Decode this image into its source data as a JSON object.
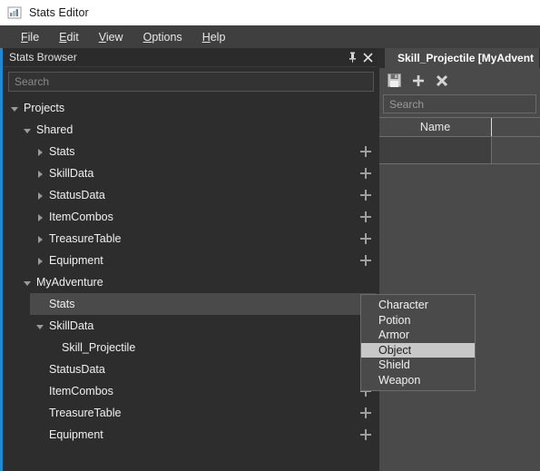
{
  "window": {
    "title": "Stats Editor",
    "icon": "bar-chart-icon"
  },
  "menubar": {
    "items": [
      {
        "label": "File",
        "accesskey": "F",
        "rest": "ile"
      },
      {
        "label": "Edit",
        "accesskey": "E",
        "rest": "dit"
      },
      {
        "label": "View",
        "accesskey": "V",
        "rest": "iew"
      },
      {
        "label": "Options",
        "accesskey": "O",
        "rest": "ptions"
      },
      {
        "label": "Help",
        "accesskey": "H",
        "rest": "elp"
      }
    ]
  },
  "stats_browser": {
    "title": "Stats Browser",
    "pin_icon": "pin-icon",
    "close_icon": "close-icon",
    "search": {
      "value": "",
      "placeholder": "Search"
    },
    "tree": [
      {
        "label": "Projects",
        "indent": 0,
        "state": "expanded",
        "plus": false,
        "selected": false
      },
      {
        "label": "Shared",
        "indent": 1,
        "state": "expanded",
        "plus": false,
        "selected": false
      },
      {
        "label": "Stats",
        "indent": 2,
        "state": "collapsed",
        "plus": true,
        "selected": false
      },
      {
        "label": "SkillData",
        "indent": 2,
        "state": "collapsed",
        "plus": true,
        "selected": false
      },
      {
        "label": "StatusData",
        "indent": 2,
        "state": "collapsed",
        "plus": true,
        "selected": false
      },
      {
        "label": "ItemCombos",
        "indent": 2,
        "state": "collapsed",
        "plus": true,
        "selected": false
      },
      {
        "label": "TreasureTable",
        "indent": 2,
        "state": "collapsed",
        "plus": true,
        "selected": false
      },
      {
        "label": "Equipment",
        "indent": 2,
        "state": "collapsed",
        "plus": true,
        "selected": false
      },
      {
        "label": "MyAdventure",
        "indent": 1,
        "state": "expanded",
        "plus": false,
        "selected": false
      },
      {
        "label": "Stats",
        "indent": 2,
        "state": "none",
        "plus": true,
        "selected": true
      },
      {
        "label": "SkillData",
        "indent": 2,
        "state": "expanded",
        "plus": true,
        "selected": false
      },
      {
        "label": "Skill_Projectile",
        "indent": 3,
        "state": "none",
        "plus": false,
        "selected": false
      },
      {
        "label": "StatusData",
        "indent": 2,
        "state": "none",
        "plus": true,
        "selected": false
      },
      {
        "label": "ItemCombos",
        "indent": 2,
        "state": "none",
        "plus": true,
        "selected": false
      },
      {
        "label": "TreasureTable",
        "indent": 2,
        "state": "none",
        "plus": true,
        "selected": false
      },
      {
        "label": "Equipment",
        "indent": 2,
        "state": "none",
        "plus": true,
        "selected": false
      }
    ]
  },
  "context_menu": {
    "items": [
      {
        "label": "Character",
        "highlighted": false
      },
      {
        "label": "Potion",
        "highlighted": false
      },
      {
        "label": "Armor",
        "highlighted": false
      },
      {
        "label": "Object",
        "highlighted": true
      },
      {
        "label": "Shield",
        "highlighted": false
      },
      {
        "label": "Weapon",
        "highlighted": false
      }
    ]
  },
  "editor": {
    "tab": {
      "label": "Skill_Projectile [MyAdvent"
    },
    "toolbar": {
      "save_icon": "save-icon",
      "add_icon": "plus-icon",
      "delete_icon": "delete-x-icon"
    },
    "search": {
      "value": "",
      "placeholder": "Search"
    },
    "grid": {
      "columns": [
        "Name",
        ""
      ],
      "rows": [
        [
          "",
          ""
        ]
      ]
    }
  },
  "colors": {
    "accent": "#1f8ad2",
    "panel_bg": "#2d2d2d",
    "editor_bg": "#4a4a4a",
    "selection": "#4a4a4a",
    "menu_highlight": "#c8c8c8",
    "titlebar_bg": "#ffffff"
  }
}
